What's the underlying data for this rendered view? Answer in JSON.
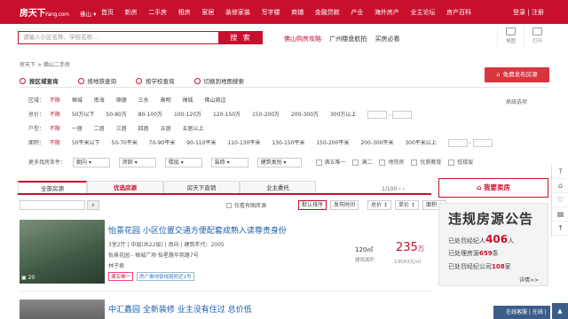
{
  "brand": {
    "logo": "房天下",
    "logo_suffix": "Fang.com",
    "city": "佛山"
  },
  "nav": [
    "首页",
    "新房",
    "二手房",
    "租房",
    "家居",
    "装修家装",
    "写字楼",
    "商铺",
    "金融贷款",
    "产业",
    "海外房产",
    "业主论坛",
    "房产百科"
  ],
  "auth": {
    "login": "登录",
    "sep": "|",
    "register": "注册"
  },
  "search": {
    "placeholder": "请输入小区名称、学校名称...",
    "button": "搜 索"
  },
  "hot_links": [
    "佛山购房攻略",
    "广州楼盘航拍",
    "买房必看"
  ],
  "tools": [
    {
      "icon": "map-icon",
      "label": "地图"
    },
    {
      "icon": "list-icon",
      "label": "打开"
    }
  ],
  "breadcrumb": "房天下 > 佛山二手房",
  "publish_button": "免费发布房源",
  "filter_tabs": [
    {
      "label": "按区域查询",
      "active": true
    },
    {
      "label": "按地铁查询"
    },
    {
      "label": "按学校查询"
    },
    {
      "label": "切换到地图搜索"
    }
  ],
  "filters": {
    "area": {
      "label": "区域：",
      "items": [
        "不限",
        "禅城",
        "南海",
        "顺德",
        "三水",
        "高明",
        "禅城",
        "佛山周边"
      ],
      "selected": 0
    },
    "price": {
      "label": "总价：",
      "items": [
        "不限",
        "50万以下",
        "50-80万",
        "80-100万",
        "100-120万",
        "120-150万",
        "150-200万",
        "200-300万",
        "300万以上"
      ],
      "selected": 0
    },
    "type": {
      "label": "户型：",
      "items": [
        "不限",
        "一居",
        "二居",
        "三居",
        "四居",
        "五居",
        "五居以上"
      ],
      "selected": 0
    },
    "size": {
      "label": "面积：",
      "items": [
        "不限",
        "50平米以下",
        "50-70平米",
        "70-90平米",
        "90-110平米",
        "110-130平米",
        "130-150平米",
        "150-200平米",
        "200-300平米",
        "300平米以上"
      ],
      "selected": 0
    },
    "advanced": "高级选项"
  },
  "more": {
    "label": "更多找房条件：",
    "dropdowns": [
      "朝向",
      "房龄",
      "楼层",
      "装修",
      "建筑类别"
    ],
    "checks": [
      "满五唯一",
      "满二",
      "地铁房",
      "优质教育",
      "低楼层"
    ]
  },
  "list_tabs": [
    "全部房源",
    "优选房源",
    "房天下直销",
    "业主委托"
  ],
  "pager": "1/100",
  "sort": {
    "check": "仅看有图房源",
    "buttons": [
      "默认排序",
      "发布时间",
      "总价",
      "单价",
      "面积"
    ]
  },
  "listings": [
    {
      "title": "怡景花园 小区位置交通方便配套成熟入读尊贵身份",
      "meta1": "3室2厅 | 中层(共22层) | 南向 | 建筑年代：2005",
      "meta2": "怡景花园 - 禅城广场·怡星路华苑路7号",
      "meta3": "林子君",
      "tags": [
        "满五唯一",
        "房广佛地铁线路附近1号"
      ],
      "photo_count": "20",
      "area": "120㎡",
      "area_label": "建筑面积",
      "price": "235",
      "price_unit": "万",
      "unit_price": "19583元/㎡"
    },
    {
      "title": "中汇鑫园 全新装修 业主没有住过 总价低"
    }
  ],
  "right": {
    "want_buy": "我要卖房",
    "ad_title": "违规房源公告",
    "ad_lines": [
      {
        "pre": "已处罚经纪人",
        "num": "406",
        "post": "人"
      },
      {
        "pre": "已处理房源",
        "num": "659",
        "post": "条"
      },
      {
        "pre": "已处罚经纪公司",
        "num": "108",
        "post": "家"
      }
    ],
    "detail": "详情>>"
  },
  "rail": [
    "?",
    "⌂",
    "♡",
    "▤",
    "↑"
  ],
  "cs": "在线客服 | 在线 |"
}
